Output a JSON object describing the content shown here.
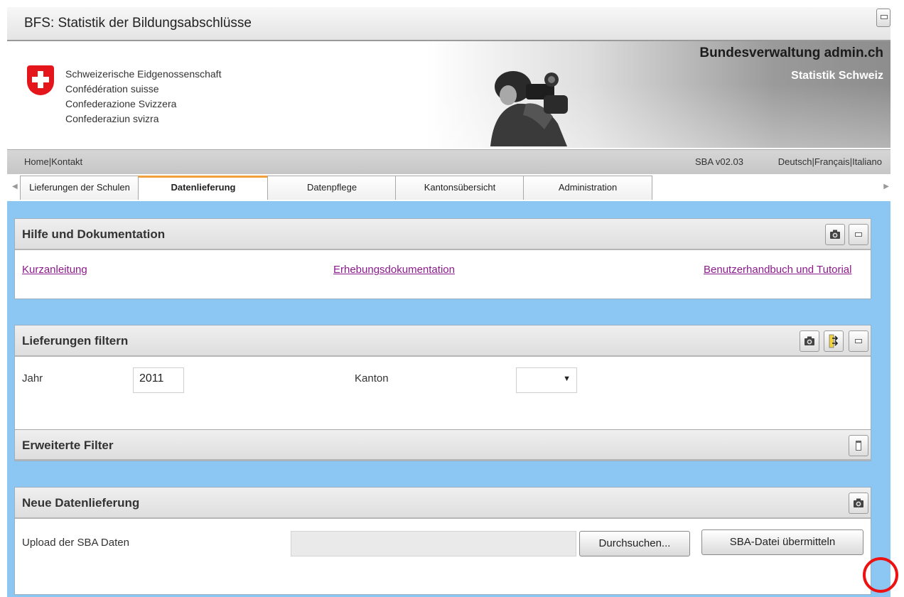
{
  "window": {
    "title": "BFS: Statistik der Bildungsabschlüsse"
  },
  "header": {
    "confederation": [
      "Schweizerische Eidgenossenschaft",
      "Confédération suisse",
      "Confederazione Svizzera",
      "Confederaziun svizra"
    ],
    "portal": "Bundesverwaltung admin.ch",
    "office": "Statistik Schweiz"
  },
  "nav": {
    "home": "Home",
    "separator": "|",
    "contact": "Kontakt",
    "version": "SBA v02.03",
    "languages": [
      "Deutsch",
      "Français",
      "Italiano"
    ]
  },
  "tabs": [
    {
      "label": "Lieferungen der Schulen",
      "active": false
    },
    {
      "label": "Datenlieferung",
      "active": true
    },
    {
      "label": "Datenpflege",
      "active": false
    },
    {
      "label": "Kantonsübersicht",
      "active": false
    },
    {
      "label": "Administration",
      "active": false
    }
  ],
  "help_panel": {
    "title": "Hilfe und Dokumentation",
    "links": [
      "Kurzanleitung",
      "Erhebungsdokumentation",
      "Benutzerhandbuch und Tutorial"
    ]
  },
  "filter_panel": {
    "title": "Lieferungen filtern",
    "year_label": "Jahr",
    "year_value": "2011",
    "canton_label": "Kanton",
    "canton_value": "",
    "extended_title": "Erweiterte Filter"
  },
  "upload_panel": {
    "title": "Neue Datenlieferung",
    "upload_label": "Upload der SBA Daten",
    "browse_button": "Durchsuchen...",
    "submit_button": "SBA-Datei übermitteln"
  },
  "colors": {
    "content_background": "#8cc7f3",
    "active_tab_accent": "#f2a03d",
    "link": "#8b1a8b",
    "swiss_red": "#e4161b",
    "annotation_circle": "#e11111"
  }
}
